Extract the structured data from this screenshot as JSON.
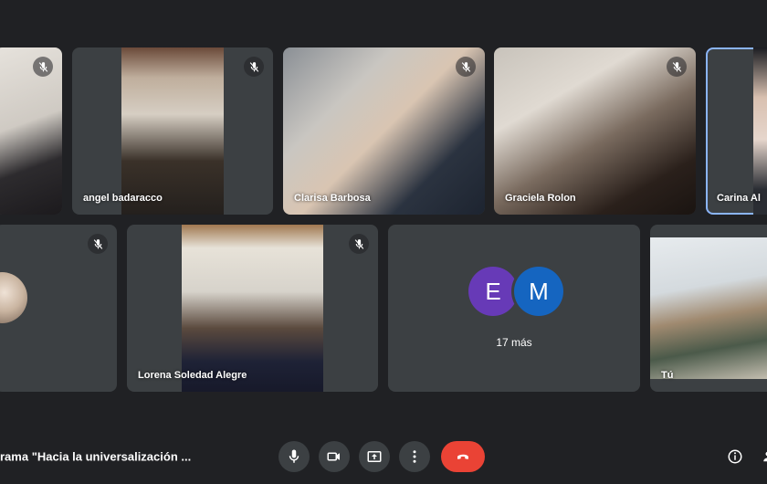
{
  "participants": [
    {
      "name": "",
      "muted": true
    },
    {
      "name": "angel badaracco",
      "muted": true
    },
    {
      "name": "Clarisa Barbosa",
      "muted": true
    },
    {
      "name": "Graciela Rolon",
      "muted": true
    },
    {
      "name": "Carina Al",
      "muted": false,
      "active_speaker": true
    },
    {
      "name": "",
      "muted": true
    },
    {
      "name": "Lorena Soledad Alegre",
      "muted": true
    },
    {
      "name": "Tú",
      "muted": false
    }
  ],
  "others": {
    "avatars": [
      {
        "initial": "E",
        "color": "#673ab7"
      },
      {
        "initial": "M",
        "color": "#1565c0"
      }
    ],
    "more_label": "17 más"
  },
  "bottom_bar": {
    "meeting_title": "rama \"Hacia la universalización ...",
    "controls": [
      "microphone-icon",
      "camera-icon",
      "present-screen-icon",
      "more-options-icon",
      "hang-up-icon"
    ],
    "right_icons": [
      "info-icon",
      "people-icon"
    ]
  },
  "colors": {
    "background": "#202124",
    "tile": "#3c4043",
    "hangup": "#ea4335",
    "active_border": "#8ab4f8"
  }
}
